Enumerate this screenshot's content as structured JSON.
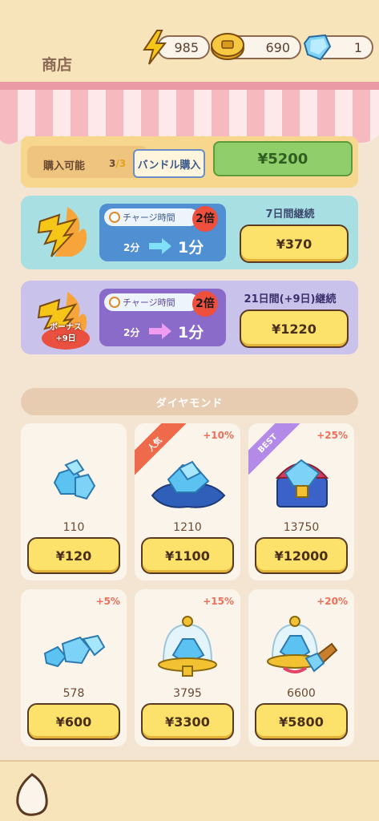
{
  "header": {
    "title": "商店",
    "resources": {
      "energy": "985",
      "coins": "690",
      "diamonds": "1"
    }
  },
  "bundle": {
    "label": "購入可能",
    "count_current": "3",
    "count_sep": "/",
    "count_max": "3",
    "button_label": "バンドル購入",
    "price": "¥5200"
  },
  "boosts": [
    {
      "charge_label": "チャージ時間",
      "multiplier": "2倍",
      "time_from": "2分",
      "time_to": "1分",
      "duration": "7日間継続",
      "price": "¥370"
    },
    {
      "charge_label": "チャージ時間",
      "multiplier": "2倍",
      "time_from": "2分",
      "time_to": "1分",
      "duration": "21日間(+9日)継続",
      "price": "¥1220",
      "bonus_line1": "ボーナス",
      "bonus_line2": "+9日"
    }
  ],
  "section": {
    "title": "ダイヤモンド"
  },
  "diamond_packs": [
    {
      "qty": "110",
      "price": "¥120",
      "bonus": "",
      "ribbon": ""
    },
    {
      "qty": "1210",
      "price": "¥1100",
      "bonus": "+10%",
      "ribbon": "人気"
    },
    {
      "qty": "13750",
      "price": "¥12000",
      "bonus": "+25%",
      "ribbon": "BEST"
    },
    {
      "qty": "578",
      "price": "¥600",
      "bonus": "+5%",
      "ribbon": ""
    },
    {
      "qty": "3795",
      "price": "¥3300",
      "bonus": "+15%",
      "ribbon": ""
    },
    {
      "qty": "6600",
      "price": "¥5800",
      "bonus": "+20%",
      "ribbon": ""
    }
  ],
  "colors": {
    "background": "#f3e5d2",
    "button_yellow": "#fce16a",
    "bonus_red": "#ef6f5a",
    "boost_blue": "#a8dfe2",
    "boost_purple": "#c9c2ea"
  },
  "icons": {
    "energy": "lightning-icon",
    "coins": "coin-icon",
    "diamonds": "diamond-icon"
  }
}
